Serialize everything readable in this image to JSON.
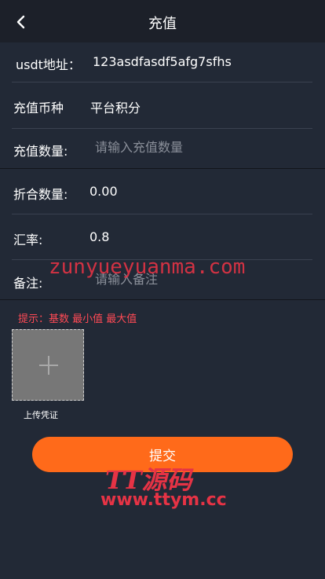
{
  "header": {
    "title": "充值"
  },
  "form": {
    "usdt_label": "usdt地址：",
    "usdt_value": "123asdfasdf5afg7sfhs",
    "currency_label": "充值币种",
    "currency_value": "平台积分",
    "amount_label": "充值数量:",
    "amount_placeholder": "请输入充值数量",
    "converted_label": "折合数量:",
    "converted_value": "0.00",
    "rate_label": "汇率:",
    "rate_value": "0.8",
    "note_label": "备注:",
    "note_placeholder": "请输入备注"
  },
  "hint": "提示：基数 最小值 最大值",
  "upload": {
    "label": "上传凭证"
  },
  "submit_label": "提交",
  "watermarks": {
    "site": "zunyueyuanma.com",
    "brand": "TT源码",
    "url": "www.ttym.cc"
  },
  "colors": {
    "accent": "#ff6a1a",
    "background": "#222936",
    "hint": "#ff4a55"
  },
  "icons": {
    "back": "chevron-left-icon",
    "upload": "plus-icon"
  }
}
